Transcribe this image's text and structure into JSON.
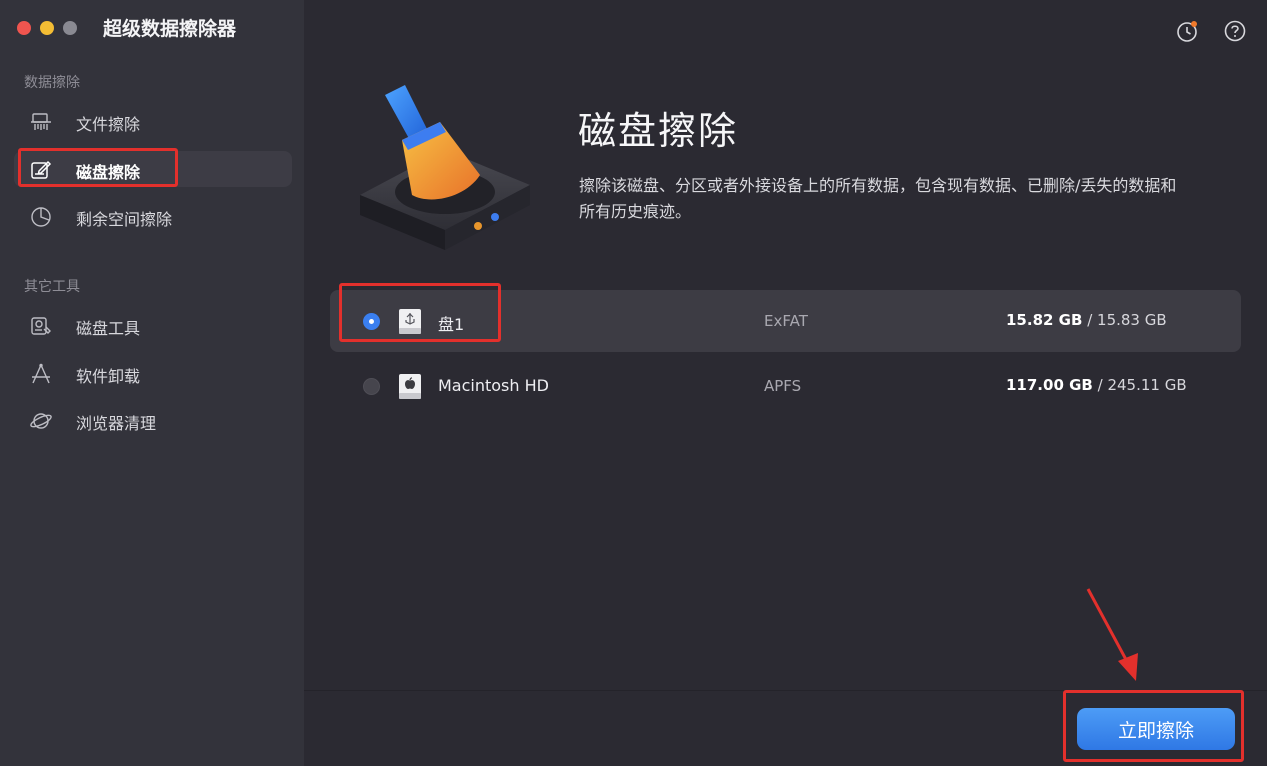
{
  "app": {
    "title": "超级数据擦除器"
  },
  "sidebar": {
    "sections": [
      {
        "label": "数据擦除",
        "items": [
          {
            "label": "文件擦除",
            "icon": "shredder-icon"
          },
          {
            "label": "磁盘擦除",
            "icon": "disk-edit-icon",
            "active": true
          },
          {
            "label": "剩余空间擦除",
            "icon": "pie-chart-icon"
          }
        ]
      },
      {
        "label": "其它工具",
        "items": [
          {
            "label": "磁盘工具",
            "icon": "disk-tool-icon"
          },
          {
            "label": "软件卸载",
            "icon": "uninstall-icon"
          },
          {
            "label": "浏览器清理",
            "icon": "planet-icon"
          }
        ]
      }
    ]
  },
  "header_icons": [
    "history-clock-icon",
    "help-icon"
  ],
  "main": {
    "title": "磁盘擦除",
    "description": "擦除该磁盘、分区或者外接设备上的所有数据，包含现有数据、已删除/丢失的数据和所有历史痕迹。",
    "disks": [
      {
        "name": "盘1",
        "fs": "ExFAT",
        "used": "15.82 GB",
        "total": "/ 15.83 GB",
        "icon": "usb-drive-icon",
        "selected": true
      },
      {
        "name": "Macintosh HD",
        "fs": "APFS",
        "used": "117.00 GB",
        "total": "/ 245.11 GB",
        "icon": "apple-drive-icon",
        "selected": false
      }
    ],
    "erase_button": "立即擦除"
  },
  "colors": {
    "accent": "#3a7ff0",
    "highlight": "#e3302c"
  }
}
